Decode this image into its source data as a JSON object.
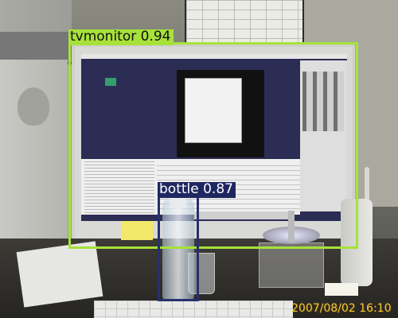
{
  "detections": [
    {
      "label": "tvmonitor 0.94",
      "color": "#a6e23a"
    },
    {
      "label": "bottle 0.87",
      "color": "#26306e"
    }
  ],
  "timestamp": "2007/08/02 16:10"
}
